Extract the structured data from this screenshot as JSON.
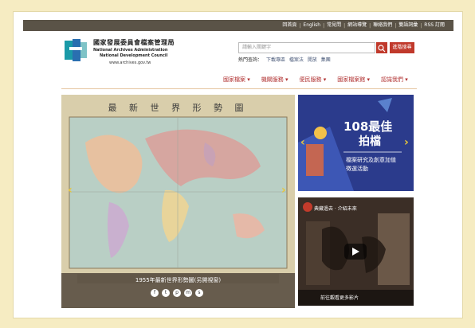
{
  "topbar": {
    "links": [
      "回首頁",
      "English",
      "常見問",
      "網站導覽",
      "聯絡我們",
      "雙語詞彙",
      "RSS 訂閱"
    ]
  },
  "logo": {
    "zh": "國家發展委員會檔案管理局",
    "en1": "National Archives Administration",
    "en2": "National Development Council",
    "url": "www.archives.gov.tw"
  },
  "search": {
    "placeholder": "請輸入關鍵字",
    "advanced_label": "進階搜尋",
    "hot_label": "熱門查詢：",
    "hot_keywords": [
      "下載專區",
      "檔案法",
      "開放",
      "集團"
    ]
  },
  "nav": [
    "國家檔案 ▾",
    "機關服務 ▾",
    "便民服務 ▾",
    "國家檔案館 ▾",
    "認識我們 ▾"
  ],
  "slider": {
    "map_title": "最 新 世 界 形 勢 圖",
    "caption": "1955年最新世界形勢圖(另開視窗)",
    "social": [
      "f",
      "t",
      "p",
      "m",
      "s"
    ]
  },
  "promo": {
    "line1": "108最佳",
    "line2": "拍檔",
    "line3": "檔案研究及創意加值",
    "line4": "徵選活動"
  },
  "video": {
    "title": "典藏過去 · 介紹未來",
    "bar_label": "前往觀看更多影片"
  },
  "colors": {
    "accent": "#c0392b",
    "topbar": "#5a5347",
    "nav": "#b03030"
  }
}
